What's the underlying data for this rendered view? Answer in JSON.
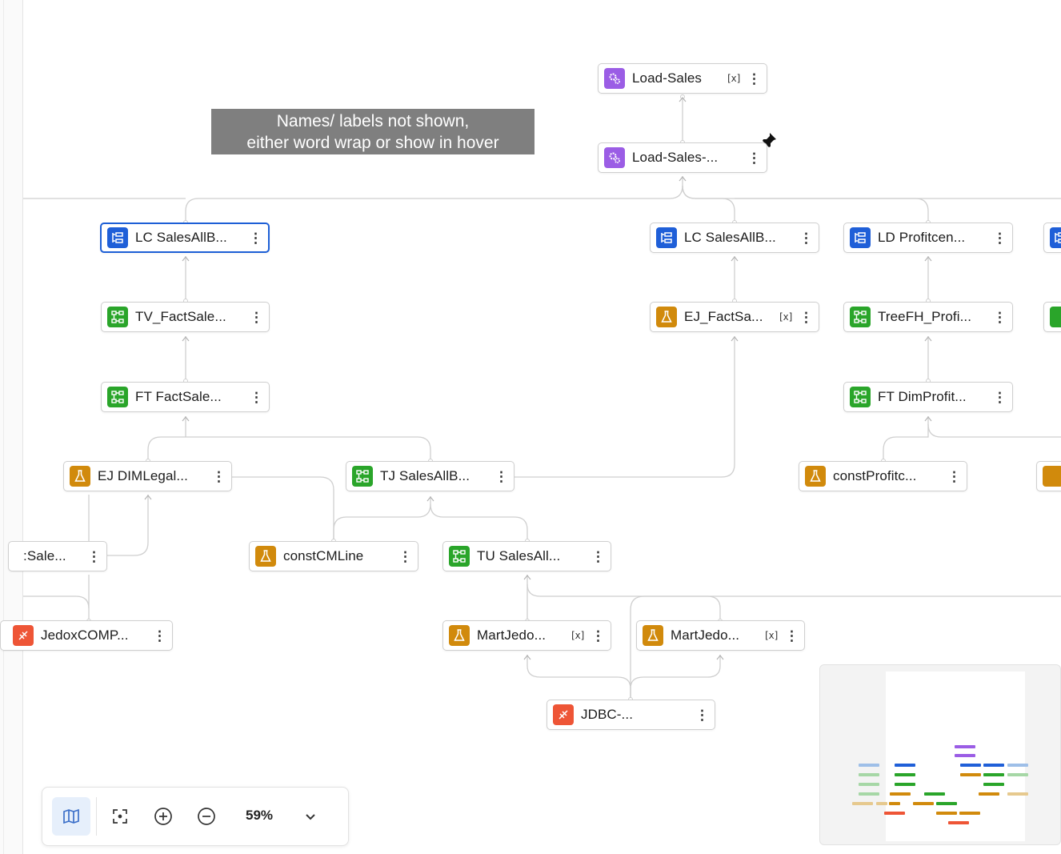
{
  "annotation": {
    "line1": "Names/ labels not shown,",
    "line2": "either word wrap or show in hover"
  },
  "colors": {
    "purple": "#9b5de5",
    "blue": "#1f5fd8",
    "green": "#2aa52a",
    "orange": "#d18a0c",
    "red": "#ee5536",
    "selected_border": "#1d5fd6"
  },
  "nodes": {
    "load_sales": {
      "label": "Load-Sales",
      "type": "job",
      "icon": "gears-icon"
    },
    "load_sales_sub": {
      "label": "Load-Sales-...",
      "type": "job",
      "icon": "gears-icon"
    },
    "lc_sales_1": {
      "label": "LC  SalesAllB...",
      "type": "load",
      "icon": "load-icon"
    },
    "lc_sales_2": {
      "label": "LC  SalesAllB...",
      "type": "load",
      "icon": "load-icon"
    },
    "ld_profitcen": {
      "label": "LD  Profitcen...",
      "type": "load",
      "icon": "load-icon"
    },
    "tv_factsale": {
      "label": "TV_FactSale...",
      "type": "transform",
      "icon": "tree-icon"
    },
    "ej_factsa": {
      "label": "EJ_FactSa...",
      "type": "extract",
      "icon": "flask-icon"
    },
    "treefh_profi": {
      "label": "TreeFH_Profi...",
      "type": "transform",
      "icon": "tree-icon"
    },
    "ft_factsale": {
      "label": "FT  FactSale...",
      "type": "transform",
      "icon": "tree-icon"
    },
    "ft_dimprofit": {
      "label": "FT  DimProfit...",
      "type": "transform",
      "icon": "tree-icon"
    },
    "ej_dimlegal": {
      "label": "EJ  DIMLegal...",
      "type": "extract",
      "icon": "flask-icon"
    },
    "tj_salesallb": {
      "label": "TJ  SalesAllB...",
      "type": "transform",
      "icon": "tree-icon"
    },
    "constprofitc": {
      "label": "constProfitc...",
      "type": "extract",
      "icon": "flask-icon"
    },
    "sale_cut": {
      "label": ":Sale...",
      "type": "extract",
      "icon": "flask-icon"
    },
    "constcmline": {
      "label": "constCMLine",
      "type": "extract",
      "icon": "flask-icon"
    },
    "tu_salesall": {
      "label": "TU  SalesAll...",
      "type": "transform",
      "icon": "tree-icon"
    },
    "jedoxcomp": {
      "label": "JedoxCOMP...",
      "type": "connection",
      "icon": "plug-icon"
    },
    "martjedo_1": {
      "label": "MartJedo...",
      "type": "extract",
      "icon": "flask-icon"
    },
    "martjedo_2": {
      "label": "MartJedo...",
      "type": "extract",
      "icon": "flask-icon"
    },
    "jdbc": {
      "label": "JDBC-...",
      "type": "connection",
      "icon": "plug-icon"
    }
  },
  "variable_badge": "[x]",
  "more_menu": "⋮",
  "toolbar": {
    "minimap_toggle": "map-icon",
    "fit_view": "focus-icon",
    "zoom_in": "zoom-in-icon",
    "zoom_out": "zoom-out-icon",
    "zoom_level": "59%",
    "zoom_dropdown": "chevron-down-icon"
  }
}
